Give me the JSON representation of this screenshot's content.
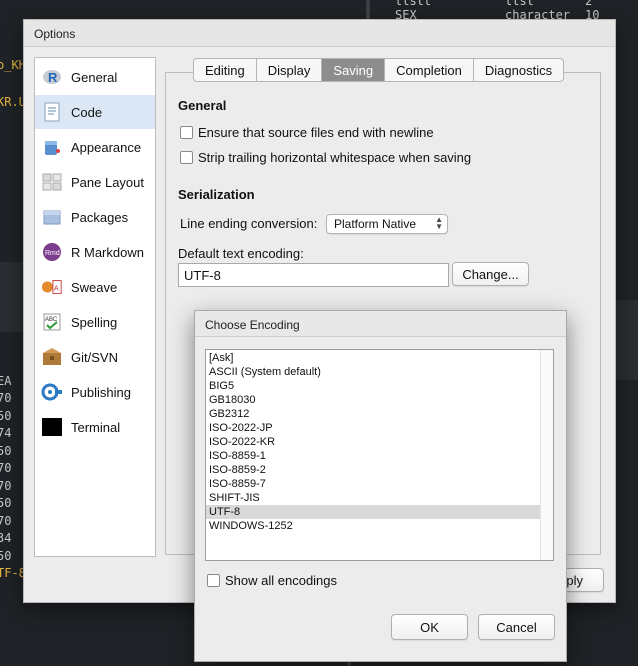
{
  "background": {
    "editor_left_lines": [
      "o_KH",
      "KR.U",
      "EA",
      "70",
      "50",
      "74",
      "50",
      "70",
      "70",
      "50",
      "70",
      "34",
      "50",
      "TF-8"
    ],
    "editor_top_right": [
      "ttstt",
      "ttst",
      "2",
      "SEX",
      "character",
      "10"
    ]
  },
  "options": {
    "title": "Options",
    "sidebar": [
      {
        "label": "General",
        "icon": "r-logo-icon"
      },
      {
        "label": "Code",
        "icon": "code-page-icon"
      },
      {
        "label": "Appearance",
        "icon": "paint-bucket-icon"
      },
      {
        "label": "Pane Layout",
        "icon": "pane-layout-icon"
      },
      {
        "label": "Packages",
        "icon": "package-box-icon"
      },
      {
        "label": "R Markdown",
        "icon": "rmd-icon"
      },
      {
        "label": "Sweave",
        "icon": "sweave-icon"
      },
      {
        "label": "Spelling",
        "icon": "spelling-icon"
      },
      {
        "label": "Git/SVN",
        "icon": "git-svn-icon"
      },
      {
        "label": "Publishing",
        "icon": "publishing-icon"
      },
      {
        "label": "Terminal",
        "icon": "terminal-icon"
      }
    ],
    "selected_sidebar": "Code",
    "tabs": [
      "Editing",
      "Display",
      "Saving",
      "Completion",
      "Diagnostics"
    ],
    "active_tab": "Saving",
    "general_heading": "General",
    "checkbox_newline": "Ensure that source files end with newline",
    "checkbox_whitespace": "Strip trailing horizontal whitespace when saving",
    "serialization_heading": "Serialization",
    "line_ending_label": "Line ending conversion:",
    "line_ending_value": "Platform Native",
    "encoding_label": "Default text encoding:",
    "encoding_value": "UTF-8",
    "change_button": "Change...",
    "apply_button_partial": "ply"
  },
  "encoding_dialog": {
    "title": "Choose Encoding",
    "items": [
      "[Ask]",
      "ASCII (System default)",
      "BIG5",
      "GB18030",
      "GB2312",
      "ISO-2022-JP",
      "ISO-2022-KR",
      "ISO-8859-1",
      "ISO-8859-2",
      "ISO-8859-7",
      "SHIFT-JIS",
      "UTF-8",
      "WINDOWS-1252"
    ],
    "selected": "UTF-8",
    "show_all_label": "Show all encodings",
    "ok_button": "OK",
    "cancel_button": "Cancel"
  },
  "colors": {
    "selected_sidebar": "#dbe7f5",
    "active_tab": "#8d8d8d",
    "selected_encoding": "#d9d9d9"
  }
}
